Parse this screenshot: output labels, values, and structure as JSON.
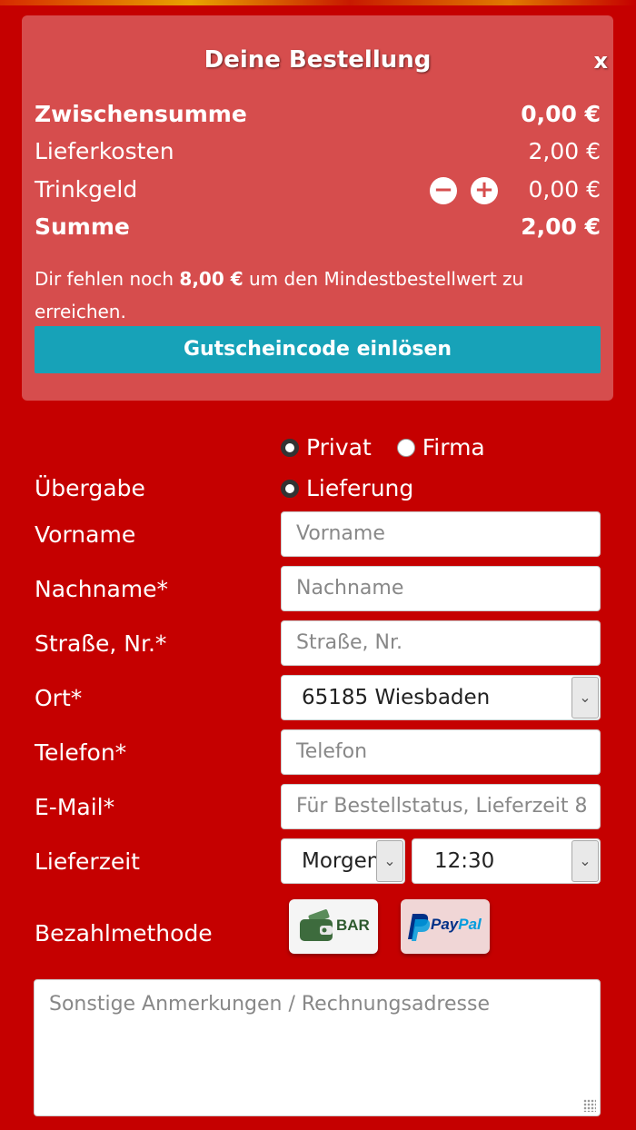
{
  "order": {
    "title": "Deine Bestellung",
    "close_label": "x",
    "subtotal_label": "Zwischensumme",
    "subtotal_value": "0,00 €",
    "delivery_label": "Lieferkosten",
    "delivery_value": "2,00 €",
    "tip_label": "Trinkgeld",
    "tip_value": "0,00 €",
    "total_label": "Summe",
    "total_value": "2,00 €",
    "note_prefix": "Dir fehlen noch ",
    "note_amount": "8,00 €",
    "note_suffix": " um den Mindestbestellwert zu erreichen.",
    "voucher_button": "Gutscheincode einlösen"
  },
  "form": {
    "customer_type": {
      "option_private": "Privat",
      "option_company": "Firma",
      "selected": "Privat"
    },
    "handover": {
      "label": "Übergabe",
      "option_delivery": "Lieferung"
    },
    "firstname": {
      "label": "Vorname",
      "placeholder": "Vorname"
    },
    "lastname": {
      "label": "Nachname*",
      "placeholder": "Nachname"
    },
    "street": {
      "label": "Straße, Nr.*",
      "placeholder": "Straße, Nr."
    },
    "city": {
      "label": "Ort*",
      "value": "65185 Wiesbaden"
    },
    "phone": {
      "label": "Telefon*",
      "placeholder": "Telefon"
    },
    "email": {
      "label": "E-Mail*",
      "placeholder": "Für Bestellstatus, Lieferzeit 8"
    },
    "delivery_time": {
      "label": "Lieferzeit",
      "day_value": "Morgen",
      "time_value": "12:30"
    },
    "payment": {
      "label": "Bezahlmethode",
      "cash_label": "BAR",
      "paypal_label": "PayPal"
    },
    "remarks": {
      "placeholder": "Sonstige Anmerkungen / Rechnungsadresse"
    }
  },
  "colors": {
    "background": "#c50000",
    "panel": "#d64d4d",
    "voucher_button": "#17a2b8",
    "paypal_dark": "#003087",
    "paypal_light": "#009cde",
    "wallet_green": "#3d6b3d"
  },
  "icons": {
    "tip_decrease": "minus-circle-icon",
    "tip_increase": "plus-circle-icon",
    "cash": "wallet-icon"
  }
}
